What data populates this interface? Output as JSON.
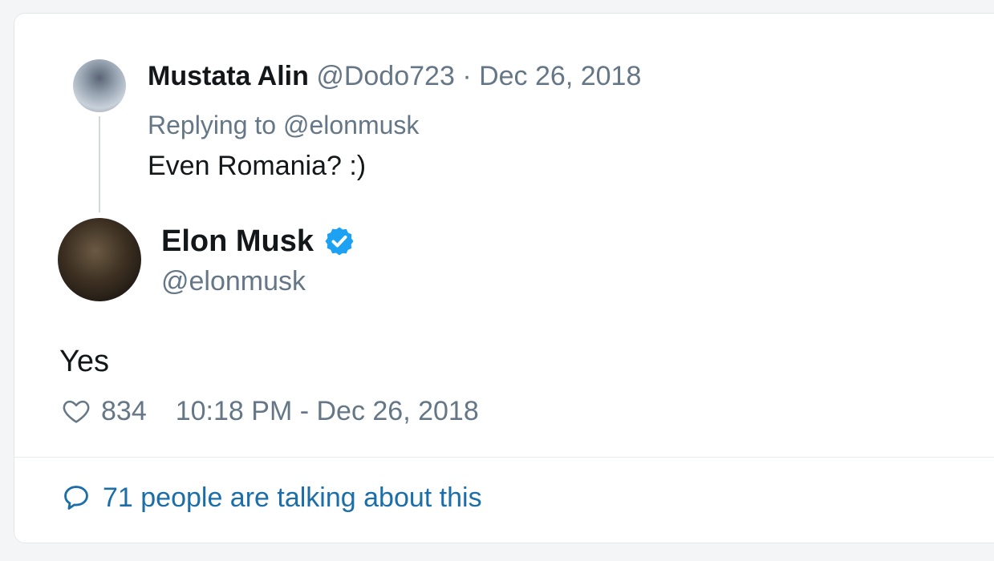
{
  "reply": {
    "name": "Mustata Alin",
    "handle": "@Dodo723",
    "separator": "·",
    "date": "Dec 26, 2018",
    "replying_to": "Replying to @elonmusk",
    "text": "Even Romania? :)"
  },
  "tweet": {
    "name": "Elon Musk",
    "verified_icon": "verified-badge-icon",
    "handle": "@elonmusk",
    "text": "Yes",
    "likes": "834",
    "timestamp": "10:18 PM - Dec 26, 2018",
    "talking": "71 people are talking about this"
  },
  "colors": {
    "text": "#14171a",
    "muted": "#657786",
    "link": "#1b6ea8",
    "verified": "#1da1f2"
  }
}
